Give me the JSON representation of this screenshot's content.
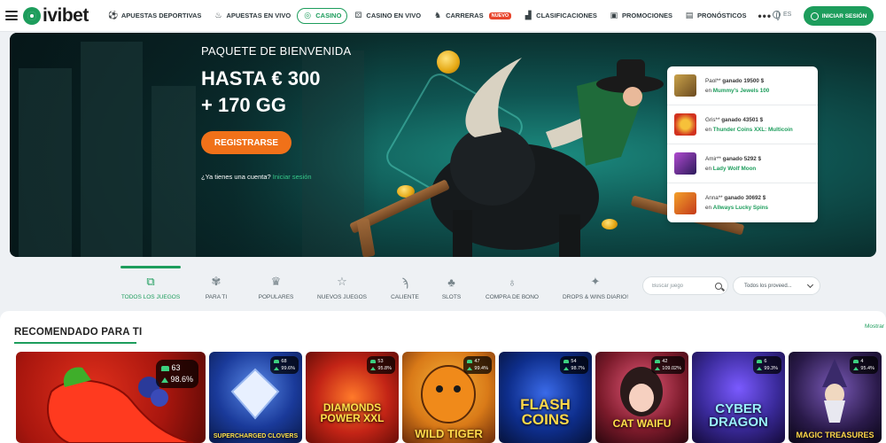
{
  "header": {
    "brand": "ivibet",
    "nav": [
      {
        "label": "APUESTAS DEPORTIVAS",
        "icon": "soccer-ball-icon",
        "active": false
      },
      {
        "label": "APUESTAS EN VIVO",
        "icon": "fire-icon",
        "active": false
      },
      {
        "label": "CASINO",
        "icon": "casino-chip-icon",
        "active": true
      },
      {
        "label": "CASINO EN VIVO",
        "icon": "dice-icon",
        "active": false
      },
      {
        "label": "CARRERAS",
        "icon": "horse-icon",
        "active": false,
        "badge": "NUEVO"
      },
      {
        "label": "CLASIFICACIONES",
        "icon": "podium-icon",
        "active": false
      },
      {
        "label": "PROMOCIONES",
        "icon": "gift-icon",
        "active": false
      },
      {
        "label": "PRONÓSTICOS",
        "icon": "forecast-icon",
        "active": false
      }
    ],
    "more": "•••",
    "language": "ES",
    "login_label": "INICIAR SESIÓN"
  },
  "hero": {
    "promo_label": "PAQUETE DE BIENVENIDA",
    "amount_line1": "HASTA € 300",
    "amount_line2": "+ 170 GG",
    "register_label": "REGISTRARSE",
    "question": "¿Ya tienes una cuenta?",
    "login_link": "Iniciar sesión"
  },
  "winners": [
    {
      "user": "Paol**",
      "won_label": "ganado",
      "amount": "19500 $",
      "prefix": "en",
      "game": "Mummy's Jewels 100",
      "thumb_color": "#6b4a1f"
    },
    {
      "user": "Gris**",
      "won_label": "ganado",
      "amount": "43501 $",
      "prefix": "en",
      "game": "Thunder Coins XXL: Multicoin",
      "thumb_color": "#d2331f"
    },
    {
      "user": "Amir**",
      "won_label": "ganado",
      "amount": "5292 $",
      "prefix": "en",
      "game": "Lady Wolf Moon",
      "thumb_color": "#5b2c8a"
    },
    {
      "user": "Anna**",
      "won_label": "ganado",
      "amount": "30692 $",
      "prefix": "en",
      "game": "Allways Lucky Spins",
      "thumb_color": "#c43a1a"
    }
  ],
  "categories": [
    {
      "label": "TODOS LOS JUEGOS",
      "icon": "all-games-icon",
      "active": true
    },
    {
      "label": "PARA TI",
      "icon": "for-you-icon",
      "active": false
    },
    {
      "label": "POPULARES",
      "icon": "crown-icon",
      "active": false
    },
    {
      "label": "NUEVOS JUEGOS",
      "icon": "star-icon",
      "active": false
    },
    {
      "label": "CALIENTE",
      "icon": "chili-icon",
      "active": false
    },
    {
      "label": "SLOTS",
      "icon": "cherry-icon",
      "active": false
    },
    {
      "label": "COMPRA DE BONO",
      "icon": "bonus-bag-icon",
      "active": false
    },
    {
      "label": "DROPS & WINS DIARIO!",
      "icon": "drops-icon",
      "active": false
    }
  ],
  "search": {
    "placeholder": "Buscar juego"
  },
  "provider": {
    "label": "Todos los proveed..."
  },
  "recommended": {
    "title": "RECOMENDADO PARA TI",
    "more_label": "Mostrar",
    "games": [
      {
        "name": "",
        "players": "63",
        "rtp": "98.6%",
        "bg": "#c41a12"
      },
      {
        "name": "SUPERCHARGED CLOVERS",
        "players": "68",
        "rtp": "99.6%",
        "bg": "#0f3a8a"
      },
      {
        "name": "DIAMONDS POWER XXL",
        "players": "53",
        "rtp": "95.8%",
        "bg": "#c32416"
      },
      {
        "name": "WILD TIGER",
        "players": "47",
        "rtp": "99.4%",
        "bg": "#d97a18"
      },
      {
        "name": "FLASH COINS",
        "players": "54",
        "rtp": "98.7%",
        "bg": "#0e2e8c"
      },
      {
        "name": "CAT WAIFU",
        "players": "42",
        "rtp": "109.02%",
        "bg": "#7a1a2a"
      },
      {
        "name": "CYBER DRAGON",
        "players": "6",
        "rtp": "99.3%",
        "bg": "#3a2a9a"
      },
      {
        "name": "MAGIC TREASURES",
        "players": "4",
        "rtp": "95.4%",
        "bg": "#2a1a4a"
      }
    ]
  },
  "colors": {
    "accent": "#1d9d5c",
    "cta": "#f07119",
    "link": "#37c98a"
  }
}
